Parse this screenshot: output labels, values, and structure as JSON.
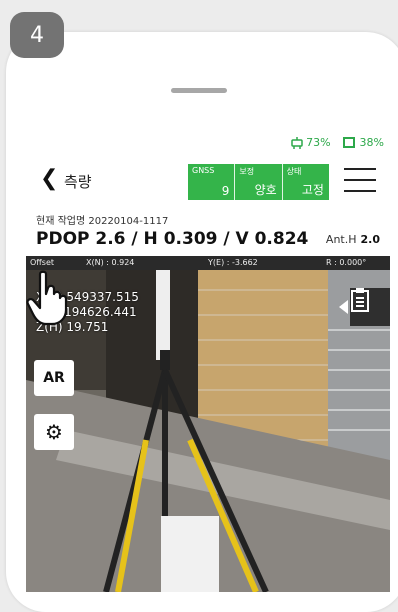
{
  "step_number": "4",
  "status_bar": {
    "gnss_pct": "73%",
    "battery_pct": "38%"
  },
  "header": {
    "back_symbol": "❮",
    "title": "측량",
    "gnss": [
      {
        "label": "GNSS",
        "value": "9"
      },
      {
        "label": "보정",
        "value": "양호"
      },
      {
        "label": "상태",
        "value": "고정"
      }
    ]
  },
  "job": {
    "label": "현재 작업명 20220104-1117"
  },
  "precision": {
    "text": "PDOP 2.6 / H 0.309 / V 0.824",
    "ant_label": "Ant.H",
    "ant_value": "2.0"
  },
  "offset": {
    "label": "Offset",
    "x": "X(N) : 0.924",
    "y": "Y(E) : -3.662",
    "r": "R : 0.000°"
  },
  "coords": {
    "x": "X(N) 549337.515",
    "y": "Y(E) 194626.441",
    "z": "Z(H) 19.751"
  },
  "buttons": {
    "ar": "AR"
  },
  "colors": {
    "accent_green": "#34b44a",
    "badge_gray": "#737373"
  }
}
